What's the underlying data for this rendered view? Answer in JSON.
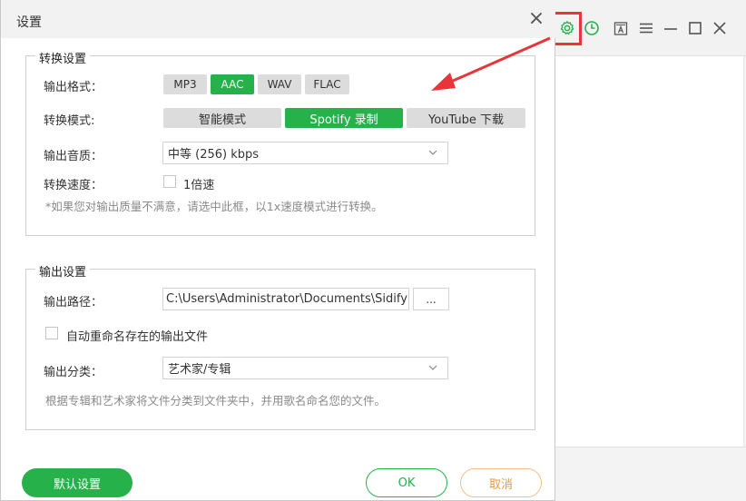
{
  "dialog": {
    "title": "设置",
    "close_glyph": "×"
  },
  "conversion": {
    "legend": "转换设置",
    "format_label": "输出格式：",
    "formats": [
      "MP3",
      "AAC",
      "WAV",
      "FLAC"
    ],
    "selected_format": "AAC",
    "mode_label": "转换模式:",
    "modes": [
      "智能模式",
      "Spotify 录制",
      "YouTube 下载"
    ],
    "selected_mode": "Spotify 录制",
    "quality_label": "输出音质：",
    "quality_value": "中等 (256) kbps",
    "speed_label": "转换速度：",
    "speed_option": "1倍速",
    "speed_checked": false,
    "hint": "*如果您对输出质量不满意，请选中此框，以1x速度模式进行转换。"
  },
  "output": {
    "legend": "输出设置",
    "path_label": "输出路径：",
    "path_value": "C:\\Users\\Administrator\\Documents\\Sidify M",
    "browse_label": "...",
    "rename_label": "自动重命名存在的输出文件",
    "rename_checked": false,
    "category_label": "输出分类：",
    "category_value": "艺术家/专辑",
    "hint": "根据专辑和艺术家将文件分类到文件夹中，并用歌名命名您的文件。"
  },
  "footer": {
    "default_label": "默认设置",
    "ok_label": "OK",
    "cancel_label": "取消"
  },
  "toolbar": {
    "icons": [
      "gear-icon",
      "history-icon",
      "text-icon",
      "menu-icon",
      "minimize-icon",
      "maximize-icon",
      "close-icon"
    ]
  },
  "colors": {
    "accent": "#27b14b",
    "highlight": "#e8353a",
    "cancel": "#e69a44"
  }
}
